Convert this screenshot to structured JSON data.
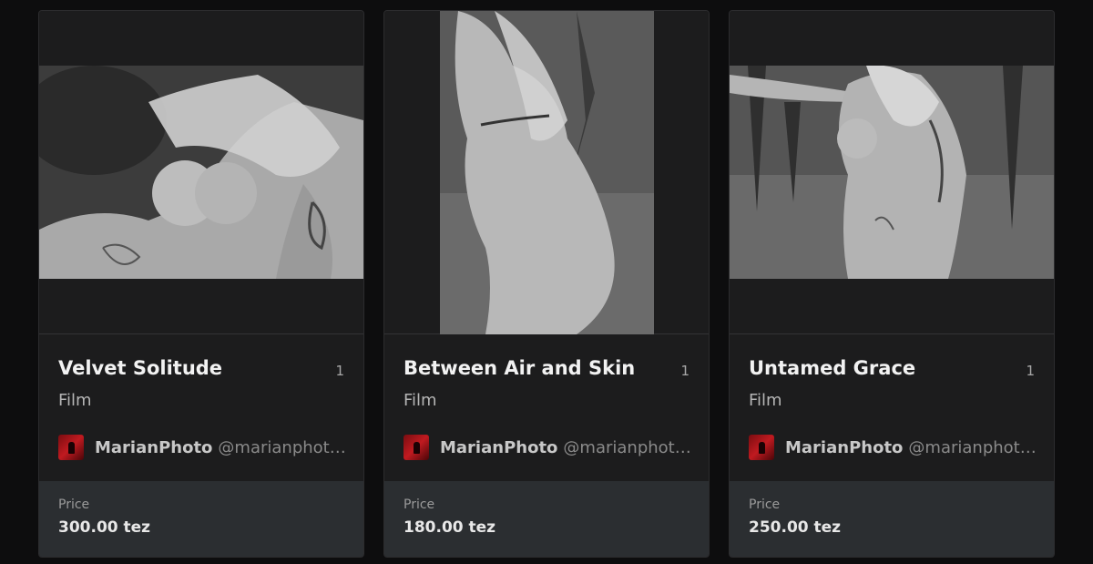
{
  "cards": [
    {
      "title": "Velvet Solitude",
      "edition": "1",
      "category": "Film",
      "creator_name": "MarianPhoto",
      "creator_handle": "@marianphotography",
      "price_label": "Price",
      "price": "300.00 tez",
      "image": "black-and-white nude photograph, landscape crop"
    },
    {
      "title": "Between Air and Skin",
      "edition": "1",
      "category": "Film",
      "creator_name": "MarianPhoto",
      "creator_handle": "@marianphotography",
      "price_label": "Price",
      "price": "180.00 tez",
      "image": "black-and-white nude photograph in forest, portrait crop"
    },
    {
      "title": "Untamed Grace",
      "edition": "1",
      "category": "Film",
      "creator_name": "MarianPhoto",
      "creator_handle": "@marianphotography",
      "price_label": "Price",
      "price": "250.00 tez",
      "image": "black-and-white nude photograph in forest, landscape crop"
    }
  ],
  "colors": {
    "page_bg": "#0d0d0e",
    "card_bg": "#1c1c1d",
    "price_bg": "#2b2e31",
    "avatar_red": "#c01a20"
  }
}
